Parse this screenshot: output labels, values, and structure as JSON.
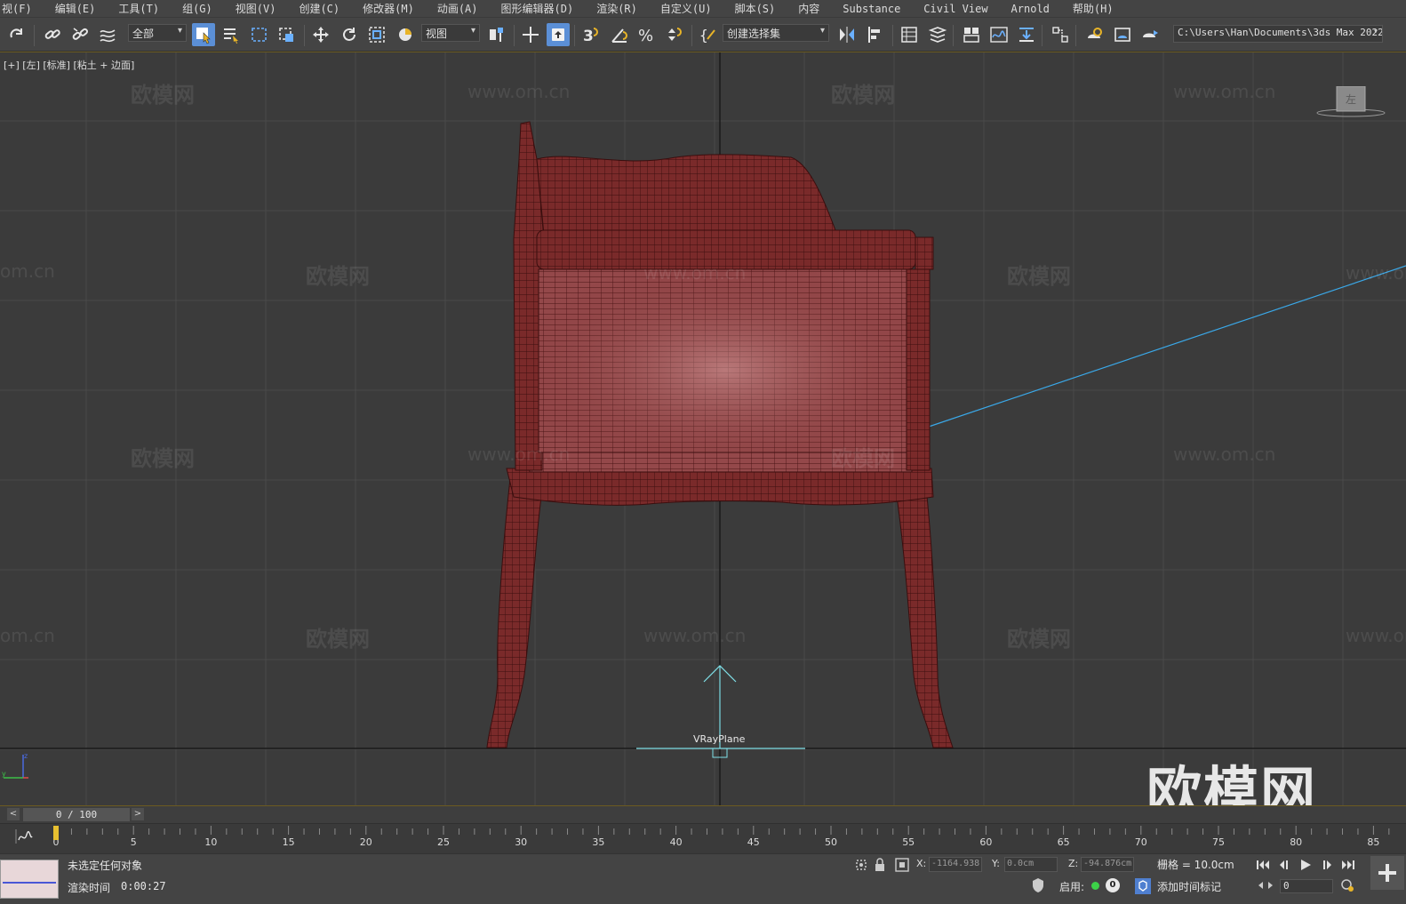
{
  "menu": [
    "视(F)",
    "编辑(E)",
    "工具(T)",
    "组(G)",
    "视图(V)",
    "创建(C)",
    "修改器(M)",
    "动画(A)",
    "图形编辑器(D)",
    "渲染(R)",
    "自定义(U)",
    "脚本(S)",
    "内容",
    "Substance",
    "Civil View",
    "Arnold",
    "帮助(H)"
  ],
  "toolbar": {
    "selection_filter": "全部",
    "ref_coord": "视图",
    "named_selection": "创建选择集",
    "path": "C:\\Users\\Han\\Documents\\3ds Max 2022"
  },
  "viewport": {
    "label": "[+] [左] [标准] [粘土 + 边面]",
    "viewcube_face": "左",
    "object_label": "VRayPlane",
    "watermark_brand": "欧模网",
    "watermark_url": "www.om.cn",
    "watermark_url_partial": "om.cn",
    "big_watermark": "欧模网",
    "mesh_color": "#7a2a2a"
  },
  "timeline": {
    "frame_display": "0 / 100",
    "prev_label": "<",
    "next_label": ">",
    "ticks": [
      "0",
      "5",
      "10",
      "15",
      "20",
      "25",
      "30",
      "35",
      "40",
      "45",
      "50",
      "55",
      "60",
      "65",
      "70",
      "75",
      "80",
      "85"
    ]
  },
  "status": {
    "message": "未选定任何对象",
    "render_time_label": "渲染时间",
    "render_time_value": "0:00:27",
    "x_label": "X:",
    "x_value": "-1164.938",
    "y_label": "Y:",
    "y_value": "0.0cm",
    "z_label": "Z:",
    "z_value": "-94.876cm",
    "grid": "栅格 = 10.0cm",
    "enable_label": "启用:",
    "enable_count": "0",
    "add_key_label": "添加时间标记",
    "frame_value": "0"
  },
  "colors": {
    "accent": "#5b8fd6",
    "viewport_bg": "#3b3b3b",
    "grid": "#4a4a4a",
    "camera_line": "#3aa8e8"
  }
}
